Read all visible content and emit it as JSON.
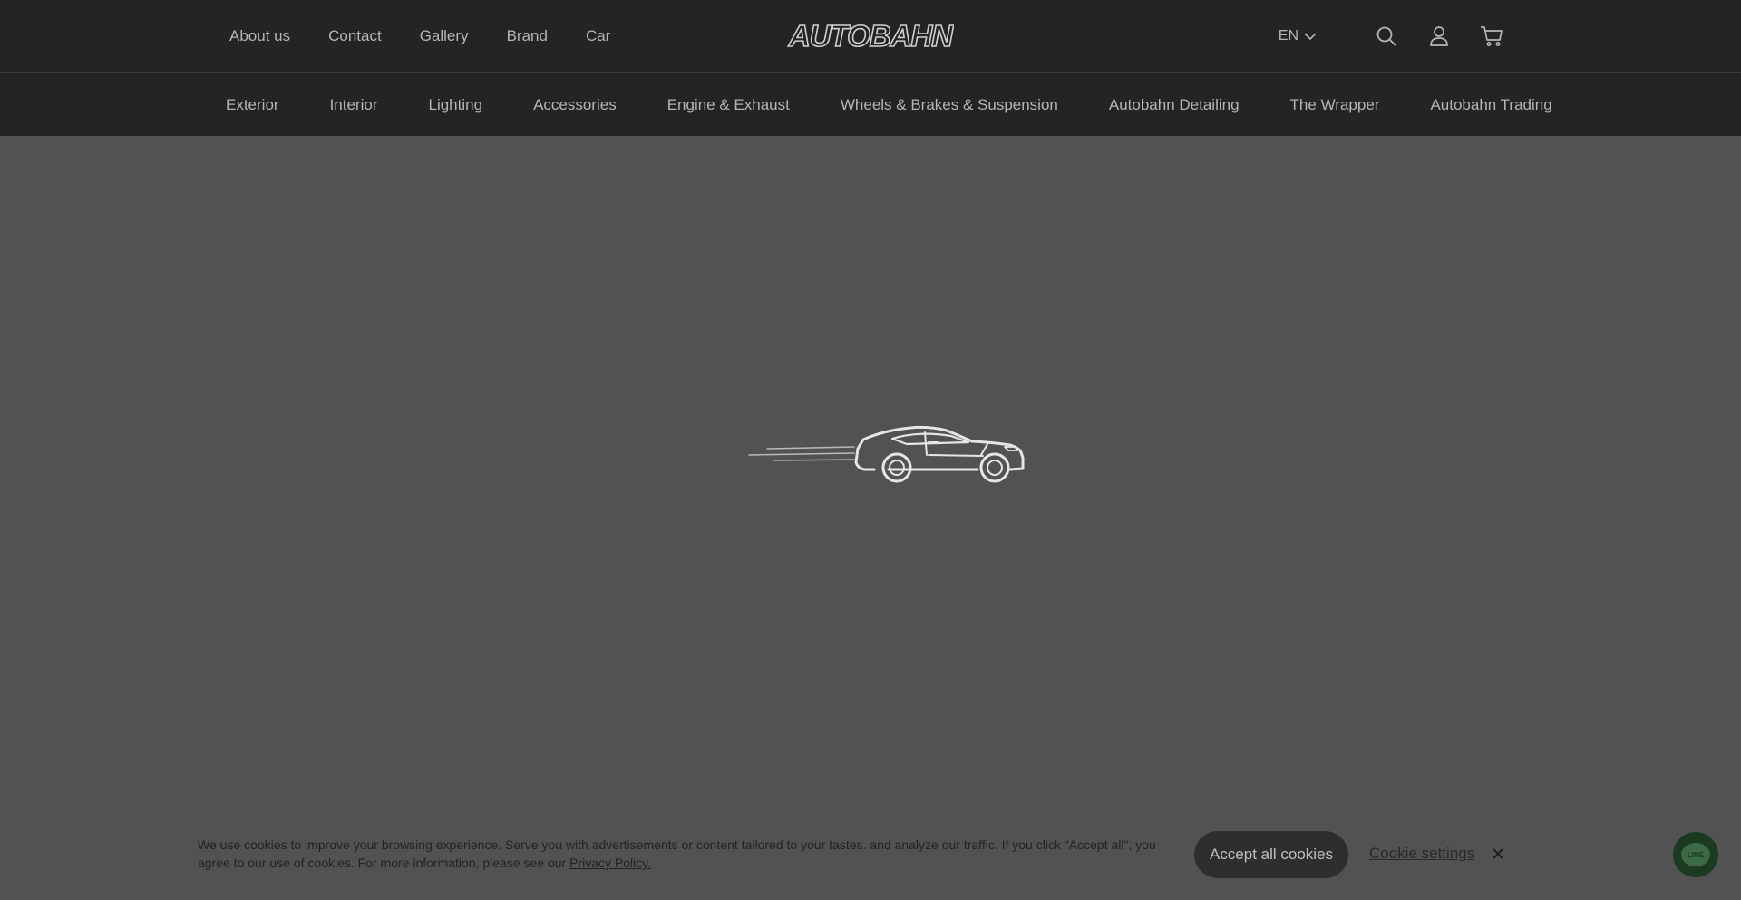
{
  "header": {
    "nav": [
      "About us",
      "Contact",
      "Gallery",
      "Brand",
      "Car"
    ],
    "logo_text": "AUTOBAHN",
    "language": "EN"
  },
  "categories": [
    "Exterior",
    "Interior",
    "Lighting",
    "Accessories",
    "Engine & Exhaust",
    "Wheels & Brakes & Suspension",
    "Autobahn Detailing",
    "The Wrapper",
    "Autobahn Trading"
  ],
  "cookie": {
    "text": "We use cookies to improve your browsing experience. Serve you with advertisements or content tailored to your tastes. and analyze our traffic. If you click \"Accept all\", you agree to our use of cookies. For more information, please see our ",
    "policy_link": "Privacy Policy.",
    "accept_label": "Accept all cookies",
    "settings_label": "Cookie settings"
  },
  "chat": {
    "label": "LINE"
  },
  "colors": {
    "header_bg": "#242424",
    "page_overlay": "#525252",
    "nav_text": "#b5b5b5",
    "chat_bg": "#1c3a22"
  }
}
